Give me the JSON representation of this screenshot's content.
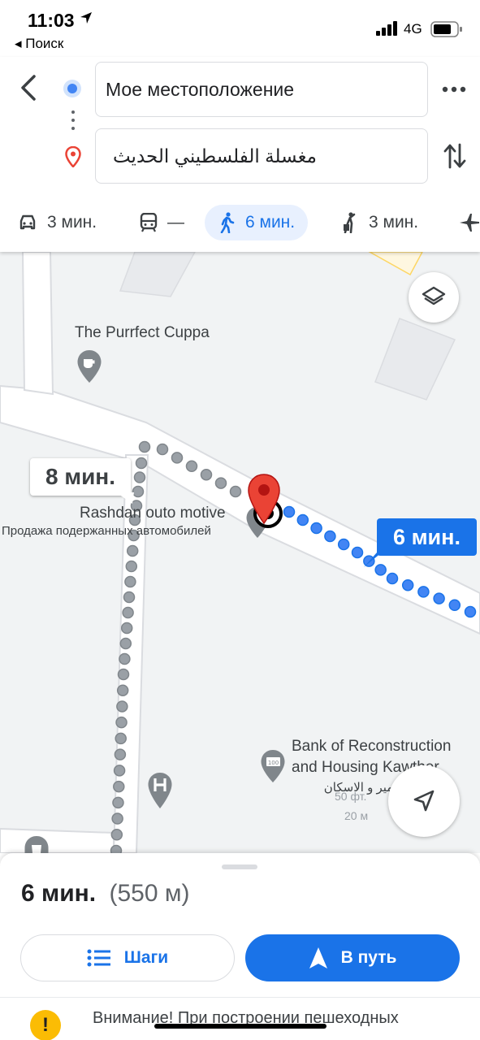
{
  "status_bar": {
    "time": "11:03",
    "back_app": "◂ Поиск",
    "network": "4G"
  },
  "directions": {
    "origin": "Мое местоположение",
    "destination": "مغسلة الفلسطيني الحديث"
  },
  "modes": [
    {
      "icon": "car-icon",
      "label": "3 мин."
    },
    {
      "icon": "transit-icon",
      "label": "—"
    },
    {
      "icon": "walk-icon",
      "label": "6 мин.",
      "active": true
    },
    {
      "icon": "rideshare-icon",
      "label": "3 мин."
    },
    {
      "icon": "flight-icon",
      "label": ""
    }
  ],
  "map": {
    "poi_cafe": "The Purrfect Cuppa",
    "poi_car_title": "Rashdan outo motive",
    "poi_car_sub": "Продажа подержанных автомобилей",
    "poi_bank_line1": "Bank of Reconstruction",
    "poi_bank_line2": "and Housing Kawther",
    "poi_bank_arabic": "بنك التعمير و الاسكان",
    "alt_route_time": "8 мин.",
    "route_time": "6 мин.",
    "scale_ft": "50 фт.",
    "scale_m": "20 м"
  },
  "sheet": {
    "duration": "6 мин.",
    "distance": "(550 м)",
    "steps_label": "Шаги",
    "go_label": "В путь",
    "warning": "Внимание! При построении пешеходных"
  },
  "colors": {
    "accent": "#1a73e8",
    "route_dot": "#4285f4",
    "alt_route": "#9aa0a6",
    "pin": "#ea4335"
  }
}
